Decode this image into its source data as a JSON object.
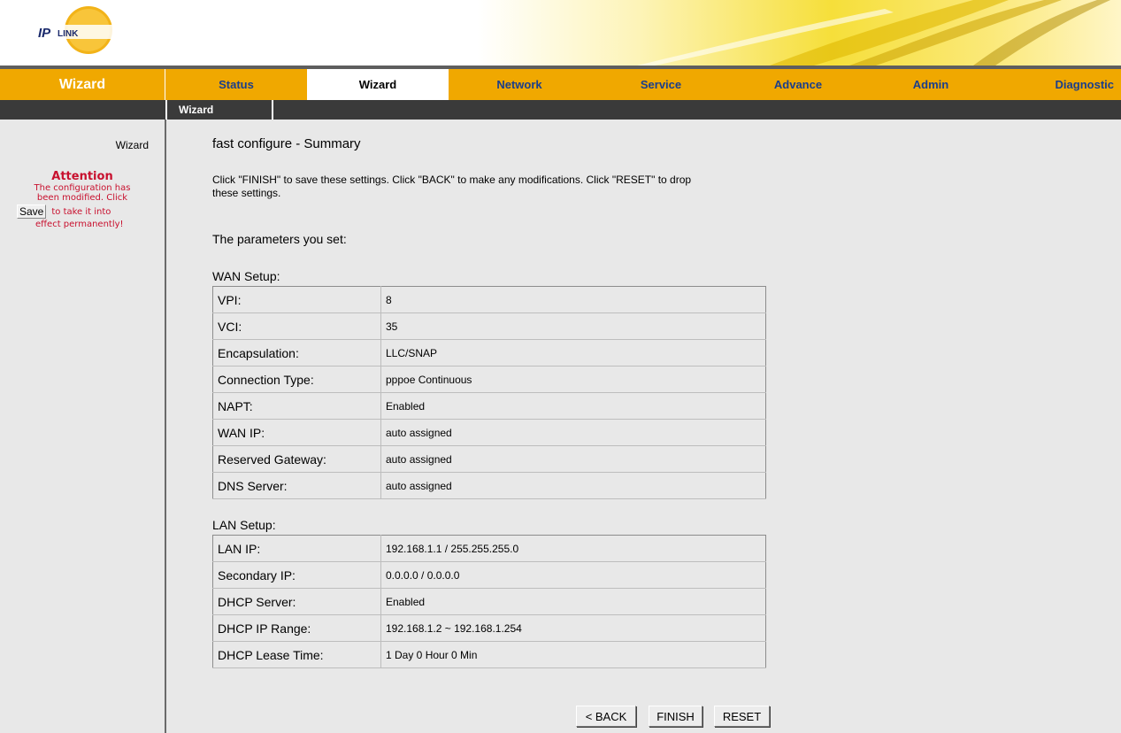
{
  "colors": {
    "nav_bar": "#f0a800",
    "sub_nav": "#3a3a3a",
    "attention_red": "#c8102e",
    "tab_text": "#1a3e8c",
    "page_bg": "#e8e8e8"
  },
  "header": {
    "logo_text": "IPLINK"
  },
  "nav": {
    "section_title": "Wizard",
    "tabs": [
      {
        "label": "Status"
      },
      {
        "label": "Wizard",
        "active": true
      },
      {
        "label": "Network"
      },
      {
        "label": "Service"
      },
      {
        "label": "Advance"
      },
      {
        "label": "Admin"
      },
      {
        "label": "Diagnostic"
      }
    ],
    "subtab": "Wizard"
  },
  "sidebar": {
    "link": "Wizard",
    "attention_title": "Attention",
    "attention_line1": "The configuration has",
    "attention_line2": "been modified. Click",
    "save_label": "Save",
    "attention_line3": "to take it into",
    "attention_line4": "effect permanently!"
  },
  "main": {
    "title": "fast configure - Summary",
    "description": "Click \"FINISH\" to save these settings. Click \"BACK\" to make any modifications. Click \"RESET\" to drop these settings.",
    "params_heading": "The parameters you set:",
    "wan_heading": "WAN Setup:",
    "wan": [
      {
        "label": "VPI:",
        "value": "8"
      },
      {
        "label": "VCI:",
        "value": "35"
      },
      {
        "label": "Encapsulation:",
        "value": "LLC/SNAP"
      },
      {
        "label": "Connection Type:",
        "value": "pppoe Continuous"
      },
      {
        "label": "NAPT:",
        "value": "Enabled"
      },
      {
        "label": "WAN IP:",
        "value": "auto assigned"
      },
      {
        "label": "Reserved Gateway:",
        "value": "auto assigned"
      },
      {
        "label": "DNS Server:",
        "value": "auto assigned"
      }
    ],
    "lan_heading": "LAN Setup:",
    "lan": [
      {
        "label": "LAN IP:",
        "value": "192.168.1.1 / 255.255.255.0"
      },
      {
        "label": "Secondary IP:",
        "value": "0.0.0.0 / 0.0.0.0"
      },
      {
        "label": "DHCP Server:",
        "value": "Enabled"
      },
      {
        "label": "DHCP IP Range:",
        "value": "192.168.1.2 ~ 192.168.1.254"
      },
      {
        "label": "DHCP Lease Time:",
        "value": "1 Day 0 Hour 0 Min"
      }
    ],
    "back_label": "< BACK",
    "finish_label": "FINISH",
    "reset_label": "RESET"
  }
}
